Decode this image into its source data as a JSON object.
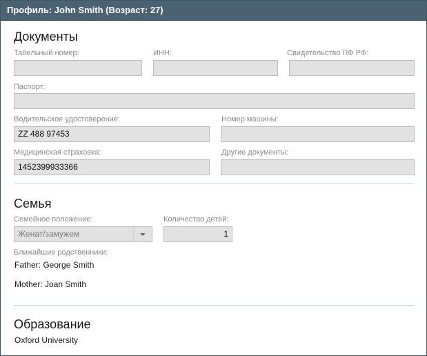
{
  "window": {
    "title": "Профиль: John Smith (Возраст: 27)"
  },
  "documents": {
    "heading": "Документы",
    "tab_number": {
      "label": "Табельный номер:",
      "value": ""
    },
    "inn": {
      "label": "ИНН:",
      "value": ""
    },
    "pension_cert": {
      "label": "Свидетельство ПФ РФ:",
      "value": ""
    },
    "passport": {
      "label": "Паспорт:",
      "value": ""
    },
    "drivers_license": {
      "label": "Водительское удостоверение:",
      "value": "ZZ 488 97453"
    },
    "car_number": {
      "label": "Номер машины:",
      "value": ""
    },
    "medical_insurance": {
      "label": "Медицинская страховка:",
      "value": "1452399933366"
    },
    "other_docs": {
      "label": "Другие документы:",
      "value": ""
    }
  },
  "family": {
    "heading": "Семья",
    "marital_status": {
      "label": "Семейное положение:",
      "value": "Женат/замужем"
    },
    "children_count": {
      "label": "Количество детей:",
      "value": "1"
    },
    "relatives": {
      "label": "Ближайшие родственники:",
      "items": [
        "Father: George Smith",
        "Mother: Joan Smith"
      ]
    }
  },
  "education": {
    "heading": "Образование",
    "value": "Oxford University"
  },
  "colors": {
    "titlebar": "#4b6272",
    "field_bg": "#e2e2e2",
    "divider": "#c9d6d6"
  },
  "icons": {
    "dropdown": "chevron-down-icon"
  }
}
